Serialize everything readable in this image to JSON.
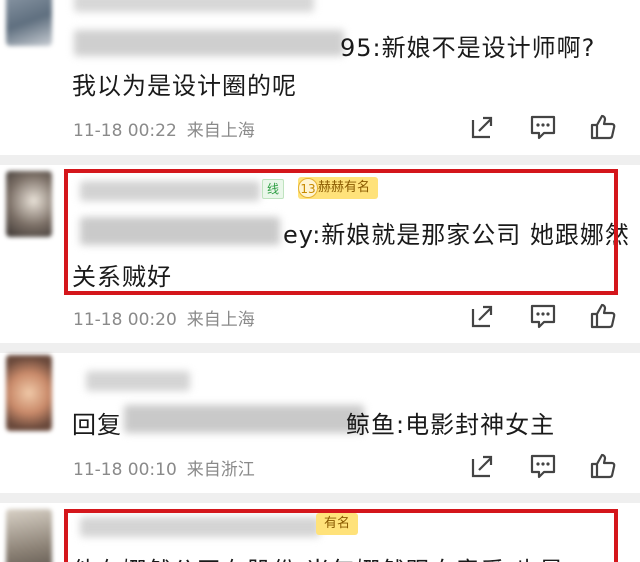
{
  "comments": [
    {
      "reply_suffix": "95:新娘不是设计师啊?",
      "continuation": "我以为是设计圈的呢",
      "date": "11-18 00:22",
      "location": "来自上海"
    },
    {
      "member_badge_fragment": "线",
      "level": "13",
      "honor_badge": "赫赫有名",
      "reply_suffix": "ey:新娘就是那家公司 她跟娜然",
      "continuation": "关系贼好",
      "date": "11-18 00:20",
      "location": "来自上海"
    },
    {
      "reply_prefix": "回复",
      "reply_suffix": "鲸鱼:电影封神女主",
      "date": "11-18 00:10",
      "location": "来自浙江"
    },
    {
      "honor_badge": "有名",
      "partial_text": "他有娜然公司有股份 当年娜然跟自意爱 也是"
    }
  ],
  "actions": {
    "share_icon": "share-icon",
    "comment_icon": "comment-icon",
    "like_icon": "thumbs-up-icon"
  },
  "colors": {
    "highlight_border": "#d4161b",
    "meta_text": "#8a8a8a",
    "badge_bg": "#ffe27a"
  }
}
